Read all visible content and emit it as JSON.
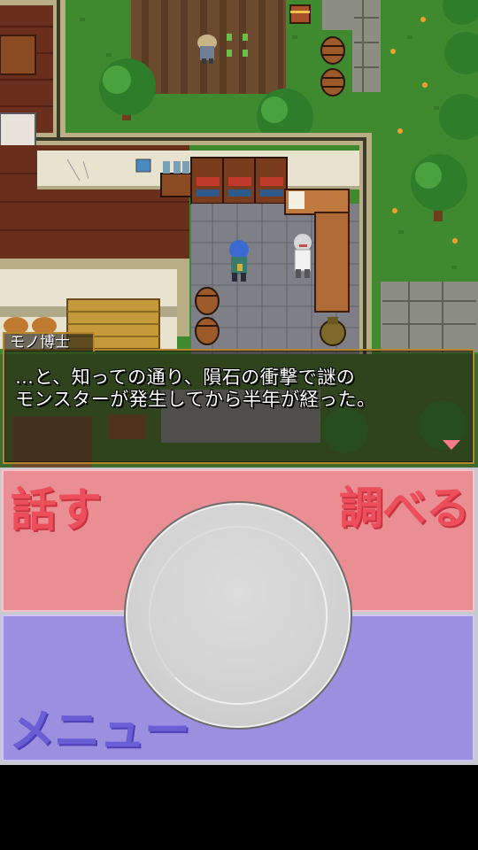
{
  "scene": {
    "description_free": true,
    "colors": {
      "grass": "#3f8a2e",
      "grass_dark": "#2f6e22",
      "wall_top": "#b9ae86",
      "wall_shadow": "#3a3a2a",
      "floor_wood": "#6a2e1c",
      "floor_stone": "#7f8087",
      "plaster": "#e7e3cf",
      "counter": "#b06a35",
      "cliff": "#8d8e82"
    }
  },
  "dialog": {
    "speaker": "モノ博士",
    "lines": [
      "…と、知っての通り、隕石の衝撃で謎の",
      "モンスターが発生してから半年が経った。"
    ],
    "advance_icon": "advance-triangle-icon"
  },
  "controls": {
    "talk_label": "話す",
    "examine_label": "調べる",
    "menu_label": "メニュー",
    "dpad_icon": "dpad-circle-icon",
    "colors": {
      "action_panel": "#e98e93",
      "action_text": "#ec4e5b",
      "menu_panel": "#9c8fe0",
      "menu_text": "#6a5ed6"
    }
  }
}
